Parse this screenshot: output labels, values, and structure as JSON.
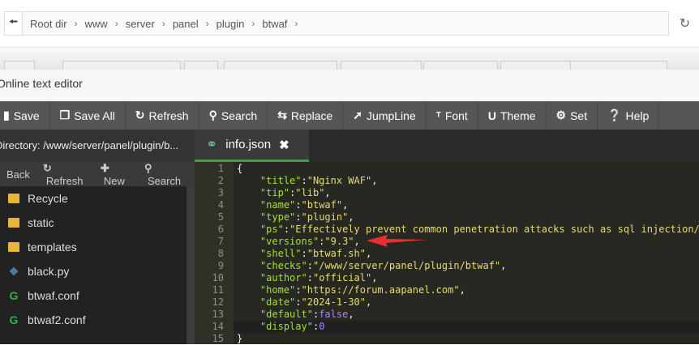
{
  "breadcrumb": [
    "Root dir",
    "www",
    "server",
    "panel",
    "plugin",
    "btwaf"
  ],
  "editor_title": "Online text editor",
  "toolbar": [
    "Save",
    "Save All",
    "Refresh",
    "Search",
    "Replace",
    "JumpLine",
    "Font",
    "Theme",
    "Set",
    "Help"
  ],
  "sidebar": {
    "directory": "Directory: /www/server/panel/plugin/b...",
    "actions": [
      "Back",
      "Refresh",
      "New",
      "Search"
    ],
    "files": [
      {
        "name": "Recycle",
        "type": "folder"
      },
      {
        "name": "static",
        "type": "folder"
      },
      {
        "name": "templates",
        "type": "folder"
      },
      {
        "name": "black.py",
        "type": "python"
      },
      {
        "name": "btwaf.conf",
        "type": "nginx"
      },
      {
        "name": "btwaf2.conf",
        "type": "nginx"
      }
    ]
  },
  "tab": {
    "label": "info.json"
  },
  "code": [
    [
      "{"
    ],
    [
      "title",
      "\"Nginx WAF\""
    ],
    [
      "tip",
      "\"lib\""
    ],
    [
      "name",
      "\"btwaf\""
    ],
    [
      "type",
      "\"plugin\""
    ],
    [
      "ps",
      "\"Effectively prevent common penetration attacks such as sql injection/x"
    ],
    [
      "versions",
      "\"9.3\""
    ],
    [
      "shell",
      "\"btwaf.sh\""
    ],
    [
      "checks",
      "\"/www/server/panel/plugin/btwaf\""
    ],
    [
      "author",
      "\"official\""
    ],
    [
      "home",
      "\"https://forum.aapanel.com\""
    ],
    [
      "date",
      "\"2024-1-30\""
    ],
    [
      "default",
      "false"
    ],
    [
      "display",
      "0"
    ],
    [
      "}"
    ]
  ],
  "colors": {
    "accent": "#2ca84a",
    "arrow": "#e8302f"
  }
}
